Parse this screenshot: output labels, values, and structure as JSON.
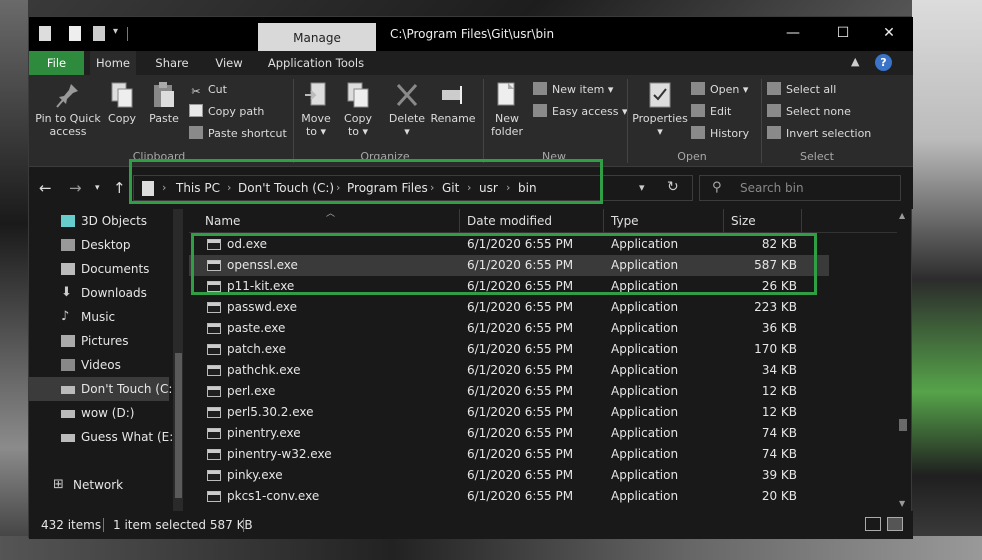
{
  "window": {
    "title": "C:\\Program Files\\Git\\usr\\bin",
    "manage_tab": "Manage",
    "minimize": "—",
    "maximize": "☐",
    "close": "✕"
  },
  "ribbon_tabs": {
    "file": "File",
    "home": "Home",
    "share": "Share",
    "view": "View",
    "application_tools": "Application Tools"
  },
  "ribbon": {
    "clipboard": {
      "label": "Clipboard",
      "pin_line1": "Pin to Quick",
      "pin_line2": "access",
      "copy": "Copy",
      "paste": "Paste",
      "cut": "Cut",
      "copy_path": "Copy path",
      "paste_shortcut": "Paste shortcut"
    },
    "organize": {
      "label": "Organize",
      "move_to_line1": "Move",
      "move_to_line2": "to ▾",
      "copy_to_line1": "Copy",
      "copy_to_line2": "to ▾",
      "delete_line1": "Delete",
      "delete_line2": "▾",
      "rename": "Rename"
    },
    "new": {
      "label": "New",
      "new_folder_line1": "New",
      "new_folder_line2": "folder",
      "new_item": "New item ▾",
      "easy_access": "Easy access ▾"
    },
    "open": {
      "label": "Open",
      "properties_line1": "Properties",
      "properties_line2": "▾",
      "open": "Open ▾",
      "edit": "Edit",
      "history": "History"
    },
    "select": {
      "label": "Select",
      "select_all": "Select all",
      "select_none": "Select none",
      "invert_selection": "Invert selection"
    }
  },
  "address": {
    "crumbs": [
      "This PC",
      "Don't Touch (C:)",
      "Program Files",
      "Git",
      "usr",
      "bin"
    ],
    "search_placeholder": "Search bin"
  },
  "nav_pane": [
    {
      "label": "3D Objects",
      "icon": "cube-icon"
    },
    {
      "label": "Desktop",
      "icon": "desktop-icon"
    },
    {
      "label": "Documents",
      "icon": "documents-icon"
    },
    {
      "label": "Downloads",
      "icon": "download-icon"
    },
    {
      "label": "Music",
      "icon": "music-icon"
    },
    {
      "label": "Pictures",
      "icon": "pictures-icon"
    },
    {
      "label": "Videos",
      "icon": "videos-icon"
    },
    {
      "label": "Don't Touch (C:)",
      "icon": "drive-icon"
    },
    {
      "label": "wow (D:)",
      "icon": "drive-icon"
    },
    {
      "label": "Guess What (E:)",
      "icon": "drive-icon"
    },
    {
      "label": "Network",
      "icon": "network-icon"
    }
  ],
  "columns": {
    "name": "Name",
    "date": "Date modified",
    "type": "Type",
    "size": "Size"
  },
  "files": [
    {
      "name": "od.exe",
      "date": "6/1/2020 6:55 PM",
      "type": "Application",
      "size": "82 KB"
    },
    {
      "name": "openssl.exe",
      "date": "6/1/2020 6:55 PM",
      "type": "Application",
      "size": "587 KB"
    },
    {
      "name": "p11-kit.exe",
      "date": "6/1/2020 6:55 PM",
      "type": "Application",
      "size": "26 KB"
    },
    {
      "name": "passwd.exe",
      "date": "6/1/2020 6:55 PM",
      "type": "Application",
      "size": "223 KB"
    },
    {
      "name": "paste.exe",
      "date": "6/1/2020 6:55 PM",
      "type": "Application",
      "size": "36 KB"
    },
    {
      "name": "patch.exe",
      "date": "6/1/2020 6:55 PM",
      "type": "Application",
      "size": "170 KB"
    },
    {
      "name": "pathchk.exe",
      "date": "6/1/2020 6:55 PM",
      "type": "Application",
      "size": "34 KB"
    },
    {
      "name": "perl.exe",
      "date": "6/1/2020 6:55 PM",
      "type": "Application",
      "size": "12 KB"
    },
    {
      "name": "perl5.30.2.exe",
      "date": "6/1/2020 6:55 PM",
      "type": "Application",
      "size": "12 KB"
    },
    {
      "name": "pinentry.exe",
      "date": "6/1/2020 6:55 PM",
      "type": "Application",
      "size": "74 KB"
    },
    {
      "name": "pinentry-w32.exe",
      "date": "6/1/2020 6:55 PM",
      "type": "Application",
      "size": "74 KB"
    },
    {
      "name": "pinky.exe",
      "date": "6/1/2020 6:55 PM",
      "type": "Application",
      "size": "39 KB"
    },
    {
      "name": "pkcs1-conv.exe",
      "date": "6/1/2020 6:55 PM",
      "type": "Application",
      "size": "20 KB"
    }
  ],
  "status": {
    "item_count": "432 items",
    "selection": "1 item selected  587 KB"
  },
  "colors": {
    "file_tab": "#2e8b3e",
    "highlight_box": "#2f9e44"
  }
}
